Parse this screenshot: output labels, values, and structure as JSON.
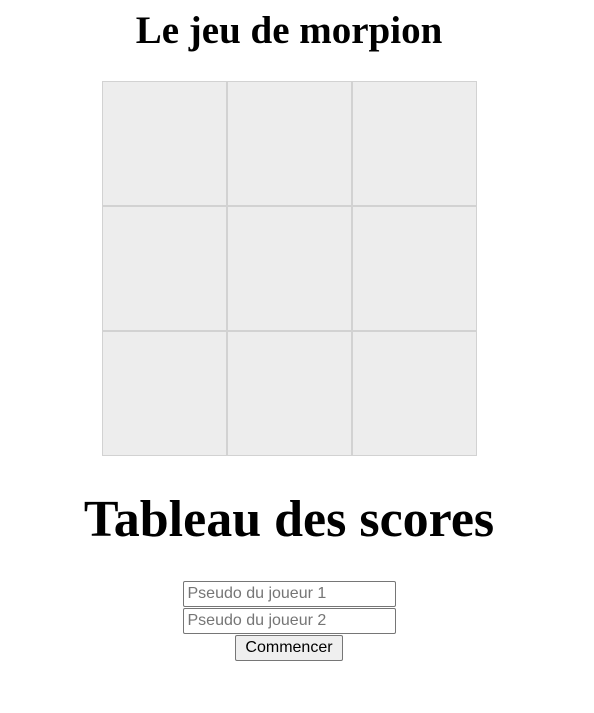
{
  "page": {
    "title": "Le jeu de morpion"
  },
  "board": {
    "cells": [
      "",
      "",
      "",
      "",
      "",
      "",
      "",
      "",
      ""
    ]
  },
  "scoreboard": {
    "title": "Tableau des scores"
  },
  "form": {
    "player1_placeholder": "Pseudo du joueur 1",
    "player2_placeholder": "Pseudo du joueur 2",
    "player1_value": "",
    "player2_value": "",
    "start_label": "Commencer"
  },
  "colors": {
    "cell_background": "#ededed",
    "cell_border": "#d2d2d2",
    "button_background": "#efefef"
  }
}
